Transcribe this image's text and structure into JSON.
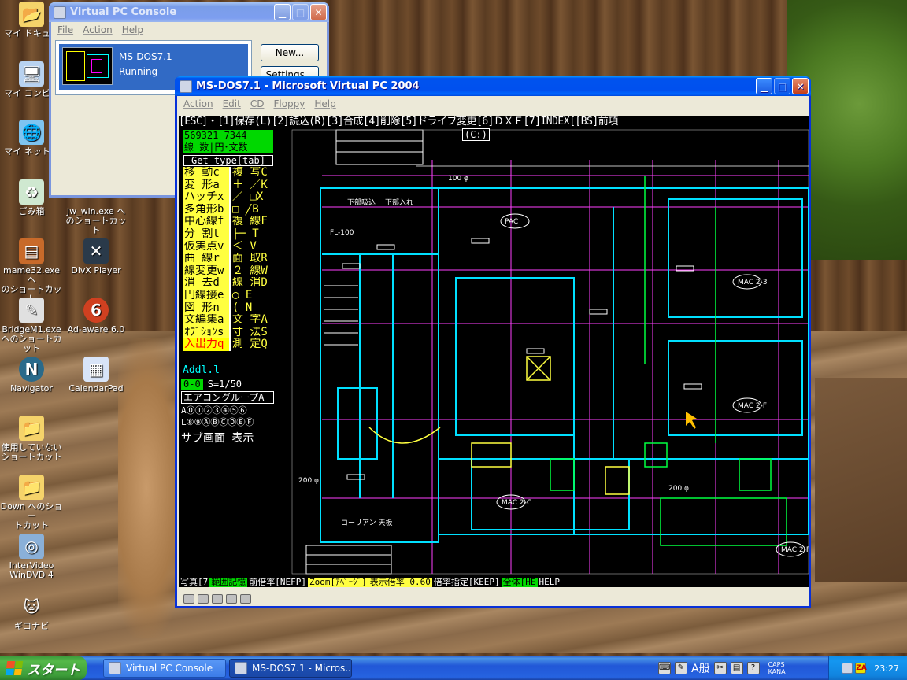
{
  "desktop": {
    "icons": [
      {
        "label": "マイ ドキュメ",
        "icon": "folder-documents-icon",
        "glyph": "📂"
      },
      {
        "label": "マイ コンピュ",
        "icon": "computer-icon",
        "glyph": "🖥"
      },
      {
        "label": "マイ ネットワ",
        "icon": "network-icon",
        "glyph": "🌐"
      },
      {
        "label": "ごみ箱",
        "icon": "recycle-bin-icon",
        "glyph": "♻"
      },
      {
        "label": "mame32.exe へ\nのショートカット",
        "icon": "mame-icon",
        "glyph": "▤"
      },
      {
        "label": "BridgeM1.exe\nへのショートカット",
        "icon": "bridge-icon",
        "glyph": "✎"
      },
      {
        "label": "Navigator",
        "icon": "navigator-icon",
        "glyph": "N"
      },
      {
        "label": "使用していない\nショートカット",
        "icon": "folder-icon",
        "glyph": "📁"
      },
      {
        "label": "Down へのショー\nトカット",
        "icon": "folder-shortcut-icon",
        "glyph": "📁"
      },
      {
        "label": "InterVideo\nWinDVD 4",
        "icon": "dvd-icon",
        "glyph": "◎"
      },
      {
        "label": "ギコナビ",
        "icon": "giko-cat-icon",
        "glyph": "🐱"
      },
      {
        "label": "Jw_win.exe へ\nのショートカット",
        "icon": "jw-win-icon",
        "glyph": ""
      },
      {
        "label": "DivX Player",
        "icon": "divx-icon",
        "glyph": "✕"
      },
      {
        "label": "Ad-aware 6.0",
        "icon": "ad-aware-icon",
        "glyph": "6"
      },
      {
        "label": "CalendarPad",
        "icon": "calendar-icon",
        "glyph": "▦"
      }
    ]
  },
  "console": {
    "title": "Virtual PC Console",
    "menu": [
      "File",
      "Action",
      "Help"
    ],
    "vm_name": "MS-DOS7.1",
    "vm_status": "Running",
    "new_button": "New...",
    "settings_button": "Settings..."
  },
  "vpc": {
    "title": "MS-DOS7.1 - Microsoft Virtual PC 2004",
    "menu": [
      "Action",
      "Edit",
      "CD",
      "Floppy",
      "Help"
    ]
  },
  "cad": {
    "cmdbar": "[ESC]・[1]保存(L)[2]読込(R)[3]合成[4]削除[5]ドライブ変更[6]ＤＸＦ[7]INDEX[[BS]前項",
    "drive": "(C:)",
    "coord_line1": "569321  7344",
    "coord_line2": "線 数|円･文数",
    "get_type": "Get type[tab]",
    "commands": [
      {
        "left": "移  動c",
        "right": "複 写C"
      },
      {
        "left": "変  形a",
        "right": " ＋ ／K"
      },
      {
        "left": "ハッチx",
        "right": " ／ □X"
      },
      {
        "left": "多角形b",
        "right": " □ ╱B"
      },
      {
        "left": "中心線f",
        "right": "複 線F"
      },
      {
        "left": "分  割t",
        "right": " ├─ T"
      },
      {
        "left": "仮実点v",
        "right": " ＜  V"
      },
      {
        "left": "曲  線r",
        "right": "面 取R"
      },
      {
        "left": "線変更w",
        "right": "２ 線W"
      },
      {
        "left": "消  去d",
        "right": "線 消D"
      },
      {
        "left": "円線接e",
        "right": " ◯  E"
      },
      {
        "left": "図  形n",
        "right": " (   N"
      },
      {
        "left": "文編集a",
        "right": "文 字A"
      },
      {
        "left": "ｵﾌﾟｼｮﾝs",
        "right": "寸 法S"
      },
      {
        "left": "入出力q",
        "right": "測 定Q"
      }
    ],
    "addl": "Addl.l",
    "layer": "0-0",
    "scale": "S=1/50",
    "group": "エアコングループA",
    "layers_a": "A⓪①②③④⑤⑥",
    "layers_l": "L⑧⑨ⒶⒷⒸⒹⒺⒻ",
    "sub_screen": "サブ画面 表示",
    "bottom_status": [
      {
        "text": "写真[7",
        "color": "#ffffff",
        "bg": "#000000"
      },
      {
        "text": "範囲記憶",
        "color": "#000000",
        "bg": "#00d800"
      },
      {
        "text": "前倍率[NEFP]",
        "color": "#ffffff",
        "bg": "#000000"
      },
      {
        "text": "Zoom[ｱﾍﾟｰｼﾞ]",
        "color": "#000000",
        "bg": "#ffff40"
      },
      {
        "text": "表示倍率 0.60",
        "color": "#000000",
        "bg": "#ffff40"
      },
      {
        "text": "倍率指定[KEEP]",
        "color": "#ffffff",
        "bg": "#000000"
      },
      {
        "text": "全体[HE",
        "color": "#000000",
        "bg": "#00d800"
      },
      {
        "text": "HELP",
        "color": "#ffffff",
        "bg": "#000000"
      }
    ],
    "labels": [
      "下部吸込",
      "下部入れ",
      "PAC",
      "MAC 2-3",
      "MAC 2-F",
      "MAC 2-C",
      "MAC 2-F",
      "コーリアン 天板",
      "FL-100",
      "100 φ",
      "200 φ",
      "200 φ"
    ]
  },
  "taskbar": {
    "start": "スタート",
    "tasks": [
      "Virtual PC Console",
      "MS-DOS7.1 - Micros..."
    ],
    "lang": "A般",
    "caps": "CAPS",
    "kana": "KANA",
    "time": "23:27"
  }
}
